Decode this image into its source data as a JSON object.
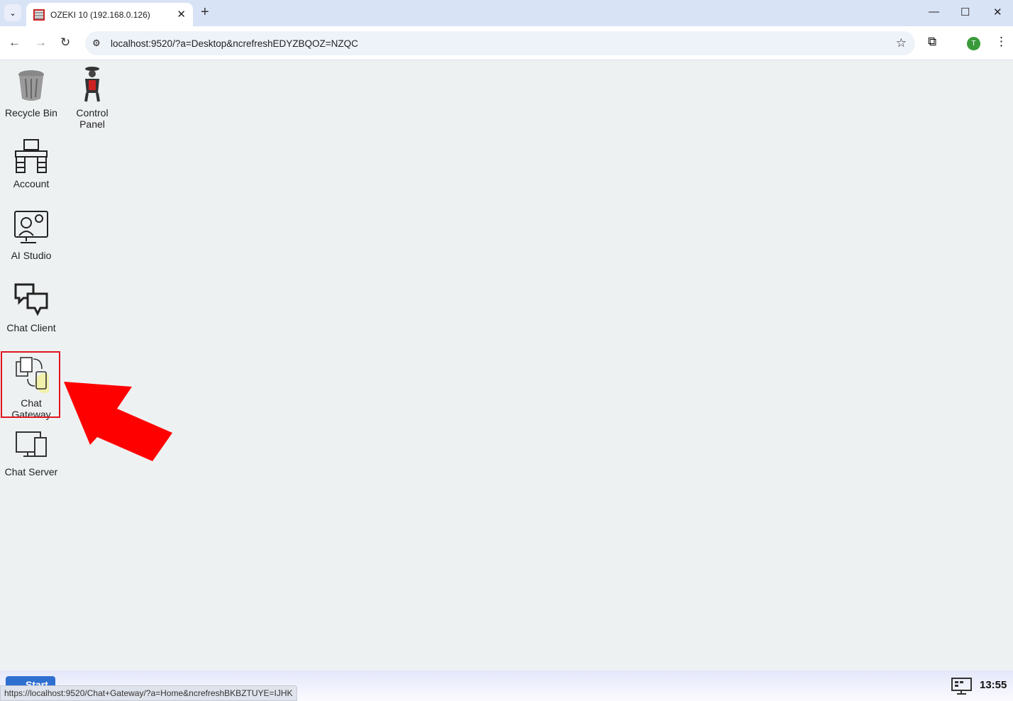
{
  "browser": {
    "tab_title": "OZEKI 10 (192.168.0.126)",
    "url": "localhost:9520/?a=Desktop&ncrefreshEDYZBQOZ=NZQC",
    "avatar_letter": "T"
  },
  "desktop": {
    "icons": [
      {
        "label": "Recycle Bin",
        "icon": "recycle-bin-icon"
      },
      {
        "label": "Control Panel",
        "icon": "control-panel-icon"
      },
      {
        "label": "Account",
        "icon": "account-icon"
      },
      {
        "label": "AI Studio",
        "icon": "ai-studio-icon"
      },
      {
        "label": "Chat Client",
        "icon": "chat-client-icon"
      },
      {
        "label": "Chat Gateway",
        "icon": "chat-gateway-icon"
      },
      {
        "label": "Chat Server",
        "icon": "chat-server-icon"
      }
    ],
    "highlight_color": "#e0141e",
    "arrow_color": "#ff0000"
  },
  "taskbar": {
    "start_label": "Start",
    "clock": "13:55",
    "status_url": "https://localhost:9520/Chat+Gateway/?a=Home&ncrefreshBKBZTUYE=IJHK"
  }
}
